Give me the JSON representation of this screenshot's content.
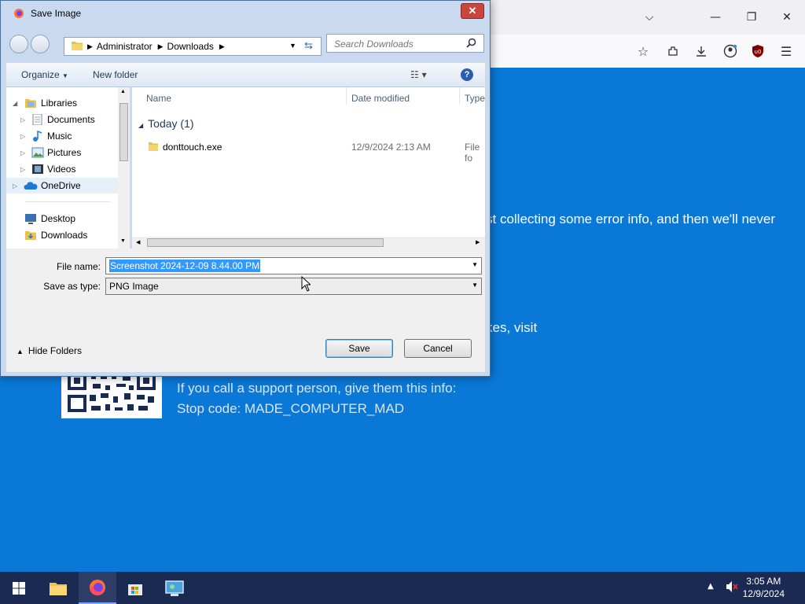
{
  "browser": {
    "toolbar_icons": [
      "star-icon",
      "extensions-icon",
      "download-icon",
      "account-icon",
      "ublock-icon",
      "menu-icon"
    ],
    "window_controls": [
      "chevron-down-icon",
      "minimize-icon",
      "restore-icon",
      "close-icon"
    ]
  },
  "bsod": {
    "line1": "st collecting some error info, and then we'll never",
    "line2": "kes, visit",
    "support_line": "If you call a support person, give them this info:",
    "stop_code": "Stop code: MADE_COMPUTER_MAD"
  },
  "dialog": {
    "title": "Save Image",
    "close": "✕",
    "breadcrumb": [
      "Administrator",
      "Downloads"
    ],
    "search_placeholder": "Search Downloads",
    "commands": {
      "organize": "Organize",
      "new_folder": "New folder"
    },
    "tree": {
      "libraries": "Libraries",
      "documents": "Documents",
      "music": "Music",
      "pictures": "Pictures",
      "videos": "Videos",
      "onedrive": "OneDrive",
      "desktop": "Desktop",
      "downloads": "Downloads"
    },
    "columns": {
      "name": "Name",
      "date_modified": "Date modified",
      "type": "Type"
    },
    "group": "Today (1)",
    "files": [
      {
        "name": "donttouch.exe",
        "date": "12/9/2024 2:13 AM",
        "type": "File fo"
      }
    ],
    "file_name_label": "File name:",
    "file_name_value": "Screenshot 2024-12-09 8.44.00 PM",
    "save_type_label": "Save as type:",
    "save_type_value": "PNG Image",
    "hide_folders": "Hide Folders",
    "save": "Save",
    "cancel": "Cancel"
  },
  "taskbar": {
    "apps": [
      "start-icon",
      "file-explorer-icon",
      "firefox-icon",
      "store-icon",
      "control-panel-icon"
    ],
    "time": "3:05 AM",
    "date": "12/9/2024"
  },
  "colors": {
    "bsod_blue": "#0a78d7",
    "selection": "#3399ff",
    "taskbar": "#1b2a52"
  }
}
